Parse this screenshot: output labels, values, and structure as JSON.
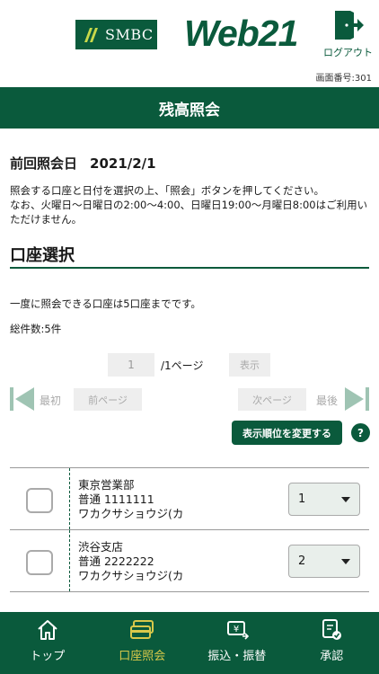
{
  "header": {
    "bank_logo_text": "SMBC",
    "service_logo_text": "Web21",
    "logout_label": "ログアウト",
    "screen_number_label": "画面番号:",
    "screen_number": "301"
  },
  "page_title": "残高照会",
  "last_inquiry": {
    "label": "前回照会日",
    "date": "2021/2/1"
  },
  "notice_line1": "照会する口座と日付を選択の上、「照会」ボタンを押してください。",
  "notice_line2": "なお、火曜日〜日曜日の2:00〜4:00、日曜日19:00〜月曜日8:00はご利用いただけません。",
  "section_title": "口座選択",
  "limit_text": "一度に照会できる口座は5口座までです。",
  "count_text": "総件数:5件",
  "pager": {
    "page_value": "1",
    "page_total": "/1ページ",
    "show_label": "表示",
    "first_label": "最初",
    "prev_label": "前ページ",
    "next_label": "次ページ",
    "last_label": "最後"
  },
  "order_button_label": "表示順位を変更する",
  "help_label": "?",
  "accounts": [
    {
      "branch": "東京営業部",
      "account": "普通 1111111",
      "holder": "ワカクサショウジ(カ",
      "order": "1"
    },
    {
      "branch": "渋谷支店",
      "account": "普通 2222222",
      "holder": "ワカクサショウジ(カ",
      "order": "2"
    }
  ],
  "tabs": [
    {
      "label": "トップ"
    },
    {
      "label": "口座照会"
    },
    {
      "label": "振込・振替"
    },
    {
      "label": "承認"
    }
  ],
  "colors": {
    "brand_green": "#0a5a3c",
    "active_tab": "#d8c84a"
  }
}
